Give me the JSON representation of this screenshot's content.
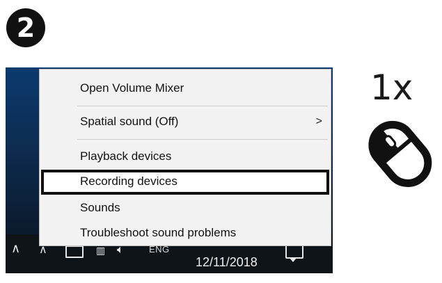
{
  "step": {
    "number": "2"
  },
  "instruction": {
    "count": "1x"
  },
  "context_menu": {
    "items": [
      {
        "label": "Open Volume Mixer",
        "has_submenu": false
      },
      {
        "label": "Spatial sound (Off)",
        "has_submenu": true,
        "submenu_glyph": ">"
      },
      {
        "label": "Playback devices",
        "has_submenu": false
      },
      {
        "label": "Recording devices",
        "has_submenu": false,
        "highlighted": true
      },
      {
        "label": "Sounds",
        "has_submenu": false
      },
      {
        "label": "Troubleshoot sound problems",
        "has_submenu": false
      }
    ]
  },
  "taskbar": {
    "language": "ENG",
    "date": "12/11/2018",
    "icons": [
      "caret-icon",
      "show-hidden-icons-icon",
      "monitor-icon",
      "network-icon",
      "speaker-icon",
      "action-center-icon"
    ]
  },
  "colors": {
    "highlight_border": "#111111",
    "menu_background": "#f2f2f2",
    "taskbar": "#0f1419"
  }
}
